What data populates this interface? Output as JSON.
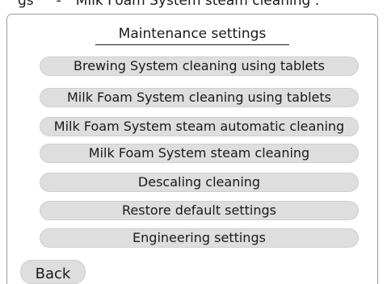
{
  "breadcrumb": {
    "parent": "gs",
    "separator": "-",
    "current": "Milk Foam System steam cleaning :"
  },
  "panel": {
    "title": "Maintenance settings"
  },
  "menu": {
    "items": [
      {
        "label": "Brewing System cleaning using tablets"
      },
      {
        "label": "Milk Foam System cleaning using tablets"
      },
      {
        "label": "Milk Foam System steam automatic cleaning"
      },
      {
        "label": "Milk Foam System steam cleaning"
      },
      {
        "label": "Descaling cleaning"
      },
      {
        "label": "Restore default settings"
      },
      {
        "label": "Engineering settings"
      }
    ]
  },
  "footer": {
    "back_label": "Back"
  },
  "colors": {
    "button_fill": "#dedede",
    "panel_border": "#9a9a9a",
    "text": "#1a1a1a"
  }
}
